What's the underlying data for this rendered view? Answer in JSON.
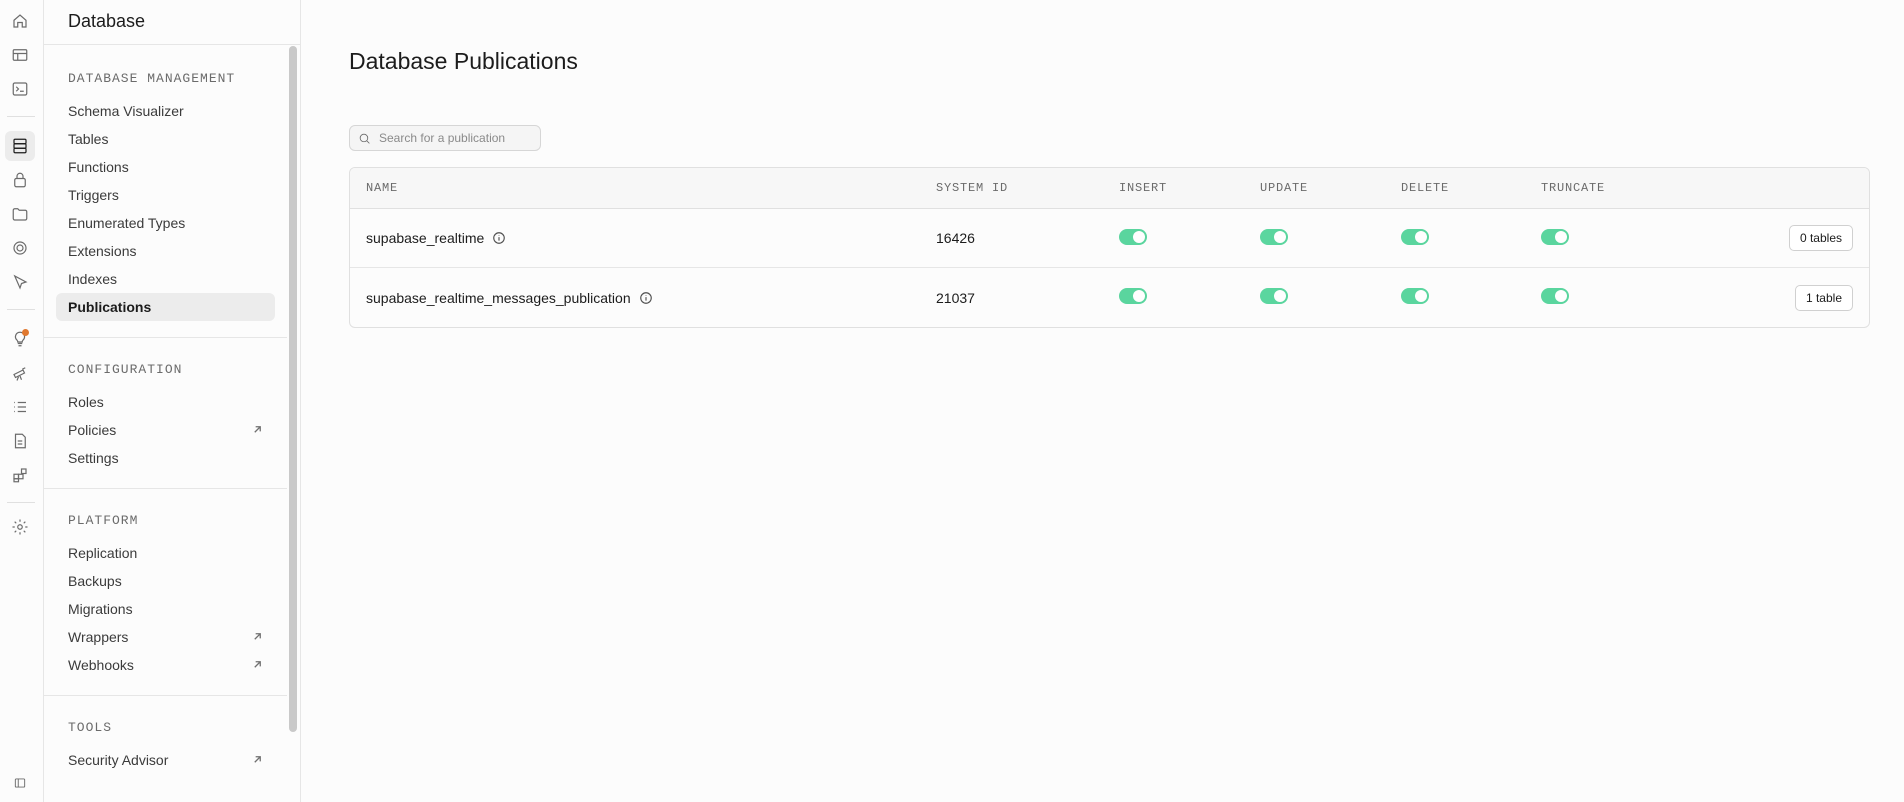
{
  "sidebar": {
    "title": "Database",
    "sections": [
      {
        "title": "DATABASE MANAGEMENT",
        "items": [
          {
            "label": "Schema Visualizer"
          },
          {
            "label": "Tables"
          },
          {
            "label": "Functions"
          },
          {
            "label": "Triggers"
          },
          {
            "label": "Enumerated Types"
          },
          {
            "label": "Extensions"
          },
          {
            "label": "Indexes"
          },
          {
            "label": "Publications"
          }
        ]
      },
      {
        "title": "CONFIGURATION",
        "items": [
          {
            "label": "Roles"
          },
          {
            "label": "Policies"
          },
          {
            "label": "Settings"
          }
        ]
      },
      {
        "title": "PLATFORM",
        "items": [
          {
            "label": "Replication"
          },
          {
            "label": "Backups"
          },
          {
            "label": "Migrations"
          },
          {
            "label": "Wrappers"
          },
          {
            "label": "Webhooks"
          }
        ]
      },
      {
        "title": "TOOLS",
        "items": [
          {
            "label": "Security Advisor"
          }
        ]
      }
    ]
  },
  "main": {
    "title": "Database Publications",
    "search": {
      "placeholder": "Search for a publication",
      "value": ""
    },
    "table": {
      "columns": [
        "NAME",
        "SYSTEM ID",
        "INSERT",
        "UPDATE",
        "DELETE",
        "TRUNCATE"
      ],
      "rows": [
        {
          "name": "supabase_realtime",
          "system_id": "16426",
          "insert": true,
          "update": true,
          "delete": true,
          "truncate": true,
          "tables_label": "0 tables"
        },
        {
          "name": "supabase_realtime_messages_publication",
          "system_id": "21037",
          "insert": true,
          "update": true,
          "delete": true,
          "truncate": true,
          "tables_label": "1 table"
        }
      ]
    }
  },
  "colors": {
    "toggle_on": "#3ecf8e",
    "notification_dot": "#e0782f",
    "active_nav_bg": "#ececec"
  },
  "icons": {
    "rail": [
      "home-icon",
      "table-editor-icon",
      "sql-editor-icon",
      "database-icon",
      "auth-icon",
      "storage-icon",
      "realtime-icon",
      "edge-functions-icon",
      "advisors-icon",
      "reports-icon",
      "logs-icon",
      "api-docs-icon",
      "integrations-icon",
      "settings-icon",
      "collapse-sidebar-icon"
    ]
  }
}
